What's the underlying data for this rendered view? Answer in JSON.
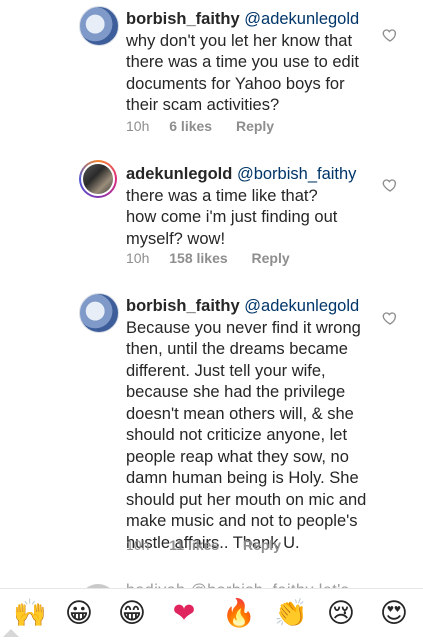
{
  "comments": [
    {
      "username": "borbish_faithy",
      "mention": "@adekunlegold",
      "lines": [
        "why don't you let her know that",
        "there was a time you use to edit",
        "documents for Yahoo boys for",
        "their scam activities?"
      ],
      "time": "10h",
      "likes": "6 likes",
      "reply": "Reply",
      "avatar": "globe-avatar"
    },
    {
      "username": "adekunlegold",
      "mention": "@borbish_faithy",
      "lines": [
        "there was a time like that?",
        "how come i'm just finding out",
        "myself? wow!"
      ],
      "time": "10h",
      "likes": "158 likes",
      "reply": "Reply",
      "avatar": "story-ring-avatar"
    },
    {
      "username": "borbish_faithy",
      "mention": "@adekunlegold",
      "lines": [
        "Because you never find it wrong",
        "then, until the dreams became",
        "different. Just tell your wife,",
        "because she had the privilege",
        "doesn't mean others will, & she",
        "should not criticize anyone, let",
        "people reap what they sow, no",
        "damn human being is Holy. She",
        "should put her mouth on mic and",
        "make music and not to people's",
        "hustle affairs.. Thank U."
      ],
      "time": "10h",
      "likes": "11 likes",
      "reply": "Reply",
      "avatar": "globe-avatar"
    }
  ],
  "partial_comment": {
    "text": "hadiyah @borbish_faithy let's"
  },
  "emoji_bar": {
    "emojis": [
      {
        "name": "raising-hands-icon",
        "glyph": "🙌"
      },
      {
        "name": "grinning-face-icon",
        "glyph": "😀"
      },
      {
        "name": "grinning-smiling-eyes-icon",
        "glyph": "😁"
      },
      {
        "name": "heart-icon",
        "glyph": "❤"
      },
      {
        "name": "fire-icon",
        "glyph": "🔥"
      },
      {
        "name": "clapping-hands-icon",
        "glyph": "👏"
      },
      {
        "name": "sad-face-icon",
        "glyph": "😢"
      },
      {
        "name": "heart-eyes-icon",
        "glyph": "😍"
      }
    ]
  },
  "colors": {
    "mention": "#003569",
    "meta": "#8e8e8e",
    "text": "#262626"
  }
}
